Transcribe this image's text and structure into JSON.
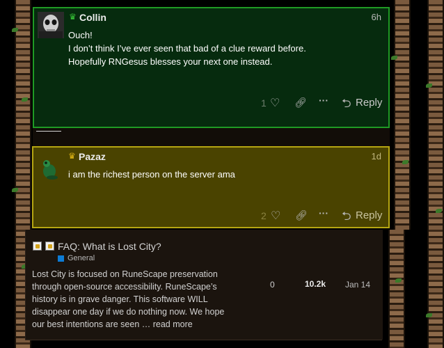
{
  "posts": [
    {
      "username": "Collin",
      "date": "6h",
      "body": [
        "Ouch!",
        "I don’t think I’ve ever seen that bad of a clue reward before.",
        "Hopefully RNGesus blesses your next one instead."
      ],
      "like_count": "1",
      "reply_label": "Reply"
    },
    {
      "username": "Pazaz",
      "date": "1d",
      "body": [
        "i am the richest person on the server ama"
      ],
      "like_count": "2",
      "reply_label": "Reply"
    }
  ],
  "topic": {
    "title": "FAQ: What is Lost City?",
    "category": "General",
    "excerpt": [
      "Lost City is focused on RuneScape preservation",
      "through open-source accessibility. RuneScape’s",
      "history is in grave danger. This software WILL",
      "disappear one day if we do nothing now. We hope",
      "our best intentions are seen …"
    ],
    "read_more": "read more",
    "replies": "0",
    "views": "10.2k",
    "activity": "Jan 14"
  },
  "colors": {
    "green_post_bg": "#062b0e",
    "green_post_border": "#1f9a24",
    "yellow_post_bg": "#4a4300",
    "yellow_post_border": "#b5a612",
    "topic_bg": "#1b140e",
    "category_badge": "#0d7bd4"
  },
  "icons": {
    "moderator_crown": "crown-icon",
    "like": "heart-icon",
    "share": "link-icon",
    "more": "ellipsis-icon",
    "reply": "reply-arrow-icon",
    "closed": "lock-icon"
  }
}
